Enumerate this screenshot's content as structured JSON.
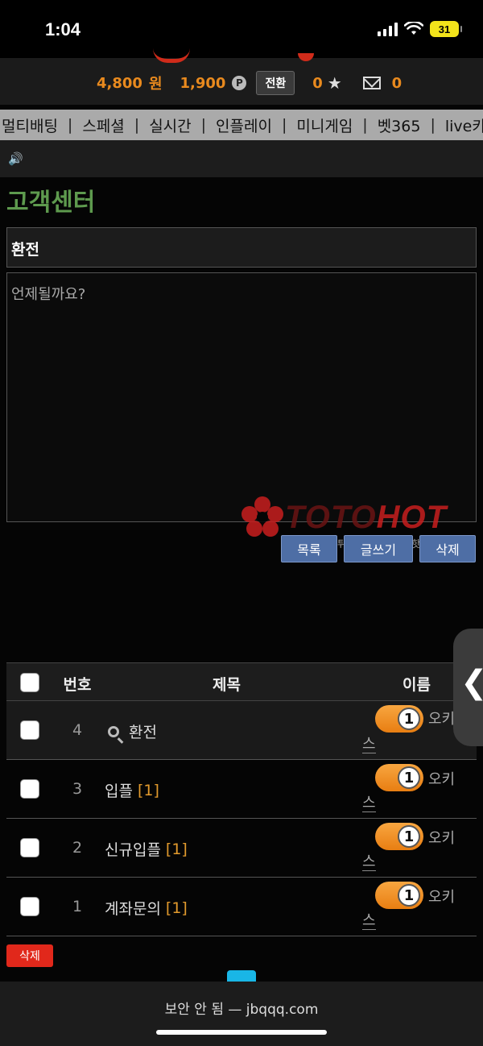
{
  "status": {
    "time": "1:04",
    "battery": "31"
  },
  "balance": {
    "money": "4,800",
    "money_unit": "원",
    "points": "1,900",
    "point_icon": "P",
    "switch_label": "전환",
    "stars": "0",
    "mails": "0"
  },
  "nav": {
    "items": [
      "멀티배팅",
      "스페셜",
      "실시간",
      "인플레이",
      "미니게임",
      "벳365",
      "live카"
    ]
  },
  "page": {
    "title": "고객센터"
  },
  "post": {
    "subject": "환전",
    "body": "언제될까요?"
  },
  "watermark": {
    "brand_a": "TOTO",
    "brand_b": "HOT",
    "sub": "먹튀검증사이트 토토핫"
  },
  "actions": {
    "list_label": "목록",
    "write_label": "글쓰기",
    "delete_label": "삭제"
  },
  "table": {
    "headers": {
      "num": "번호",
      "title": "제목",
      "writer": "이름"
    },
    "rows": [
      {
        "num": "4",
        "title": "환전",
        "comments": "",
        "level": "1",
        "writer_a": "오키",
        "writer_b": "스"
      },
      {
        "num": "3",
        "title": "입플",
        "comments": "[1]",
        "level": "1",
        "writer_a": "오키",
        "writer_b": "스"
      },
      {
        "num": "2",
        "title": "신규입플",
        "comments": "[1]",
        "level": "1",
        "writer_a": "오키",
        "writer_b": "스"
      },
      {
        "num": "1",
        "title": "계좌문의",
        "comments": "[1]",
        "level": "1",
        "writer_a": "오키",
        "writer_b": "스"
      }
    ]
  },
  "bottom": {
    "delete_label": "삭제"
  },
  "browser": {
    "url": "보안 안 됨 — jbqqq.com"
  },
  "colors": {
    "accent_orange": "#e98a1e",
    "title_green": "#5e9a4e",
    "button_blue": "#4e6ea5",
    "delete_red": "#e1281b",
    "watermark_red": "#c81e1e"
  }
}
